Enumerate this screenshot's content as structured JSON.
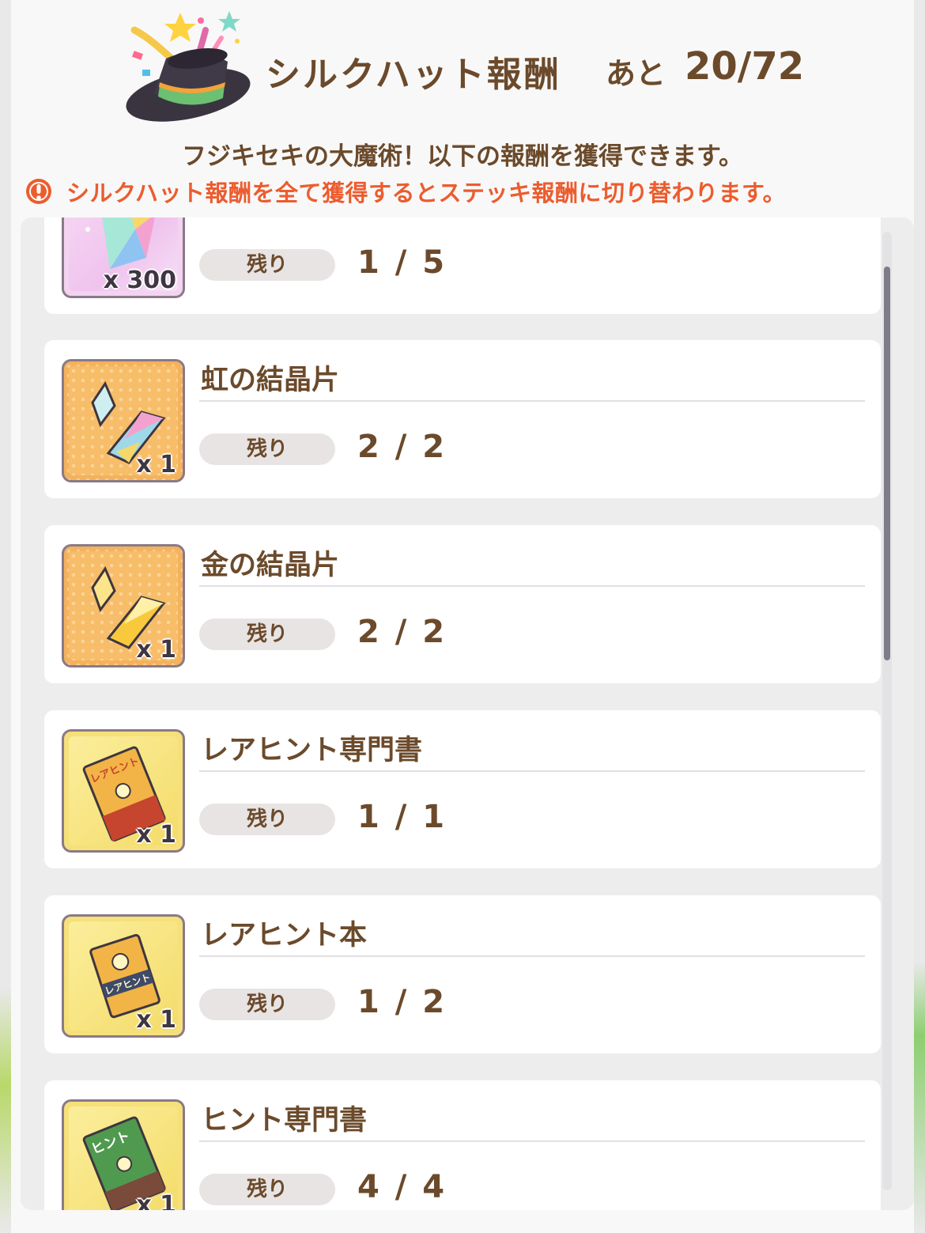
{
  "header": {
    "title": "シルクハット報酬",
    "remain_label": "あと",
    "remain_value": "20/72",
    "subtitle": "フジキセキの大魔術！以下の報酬を獲得できます。",
    "warning": "シルクハット報酬を全て獲得するとステッキ報酬に切り替わります。",
    "hat_icon": "silk-hat-icon",
    "warning_icon": "exclamation-circle-icon"
  },
  "rewards": [
    {
      "name": "",
      "icon": "rainbow-crystal-bundle-icon",
      "qty": "x 300",
      "remain_label": "残り",
      "count": "1 / 5"
    },
    {
      "name": "虹の結晶片",
      "icon": "rainbow-crystal-shard-icon",
      "qty": "x 1",
      "remain_label": "残り",
      "count": "2 / 2"
    },
    {
      "name": "金の結晶片",
      "icon": "gold-crystal-shard-icon",
      "qty": "x 1",
      "remain_label": "残り",
      "count": "2 / 2"
    },
    {
      "name": "レアヒント専門書",
      "icon": "rare-hint-textbook-icon",
      "qty": "x 1",
      "remain_label": "残り",
      "count": "1 / 1"
    },
    {
      "name": "レアヒント本",
      "icon": "rare-hint-book-icon",
      "qty": "x 1",
      "remain_label": "残り",
      "count": "1 / 2"
    },
    {
      "name": "ヒント専門書",
      "icon": "hint-textbook-icon",
      "qty": "x 1",
      "remain_label": "残り",
      "count": "4 / 4"
    }
  ],
  "book_labels": {
    "rare_hint_textbook": "レアヒント",
    "rare_hint_book": "レアヒント",
    "hint_textbook": "ヒント"
  },
  "colors": {
    "text_brown": "#6b4a2b",
    "warning_orange": "#ec5c2e",
    "panel_bg": "#f8f8f8",
    "card_bg": "#ffffff",
    "list_bg": "#ededed"
  }
}
